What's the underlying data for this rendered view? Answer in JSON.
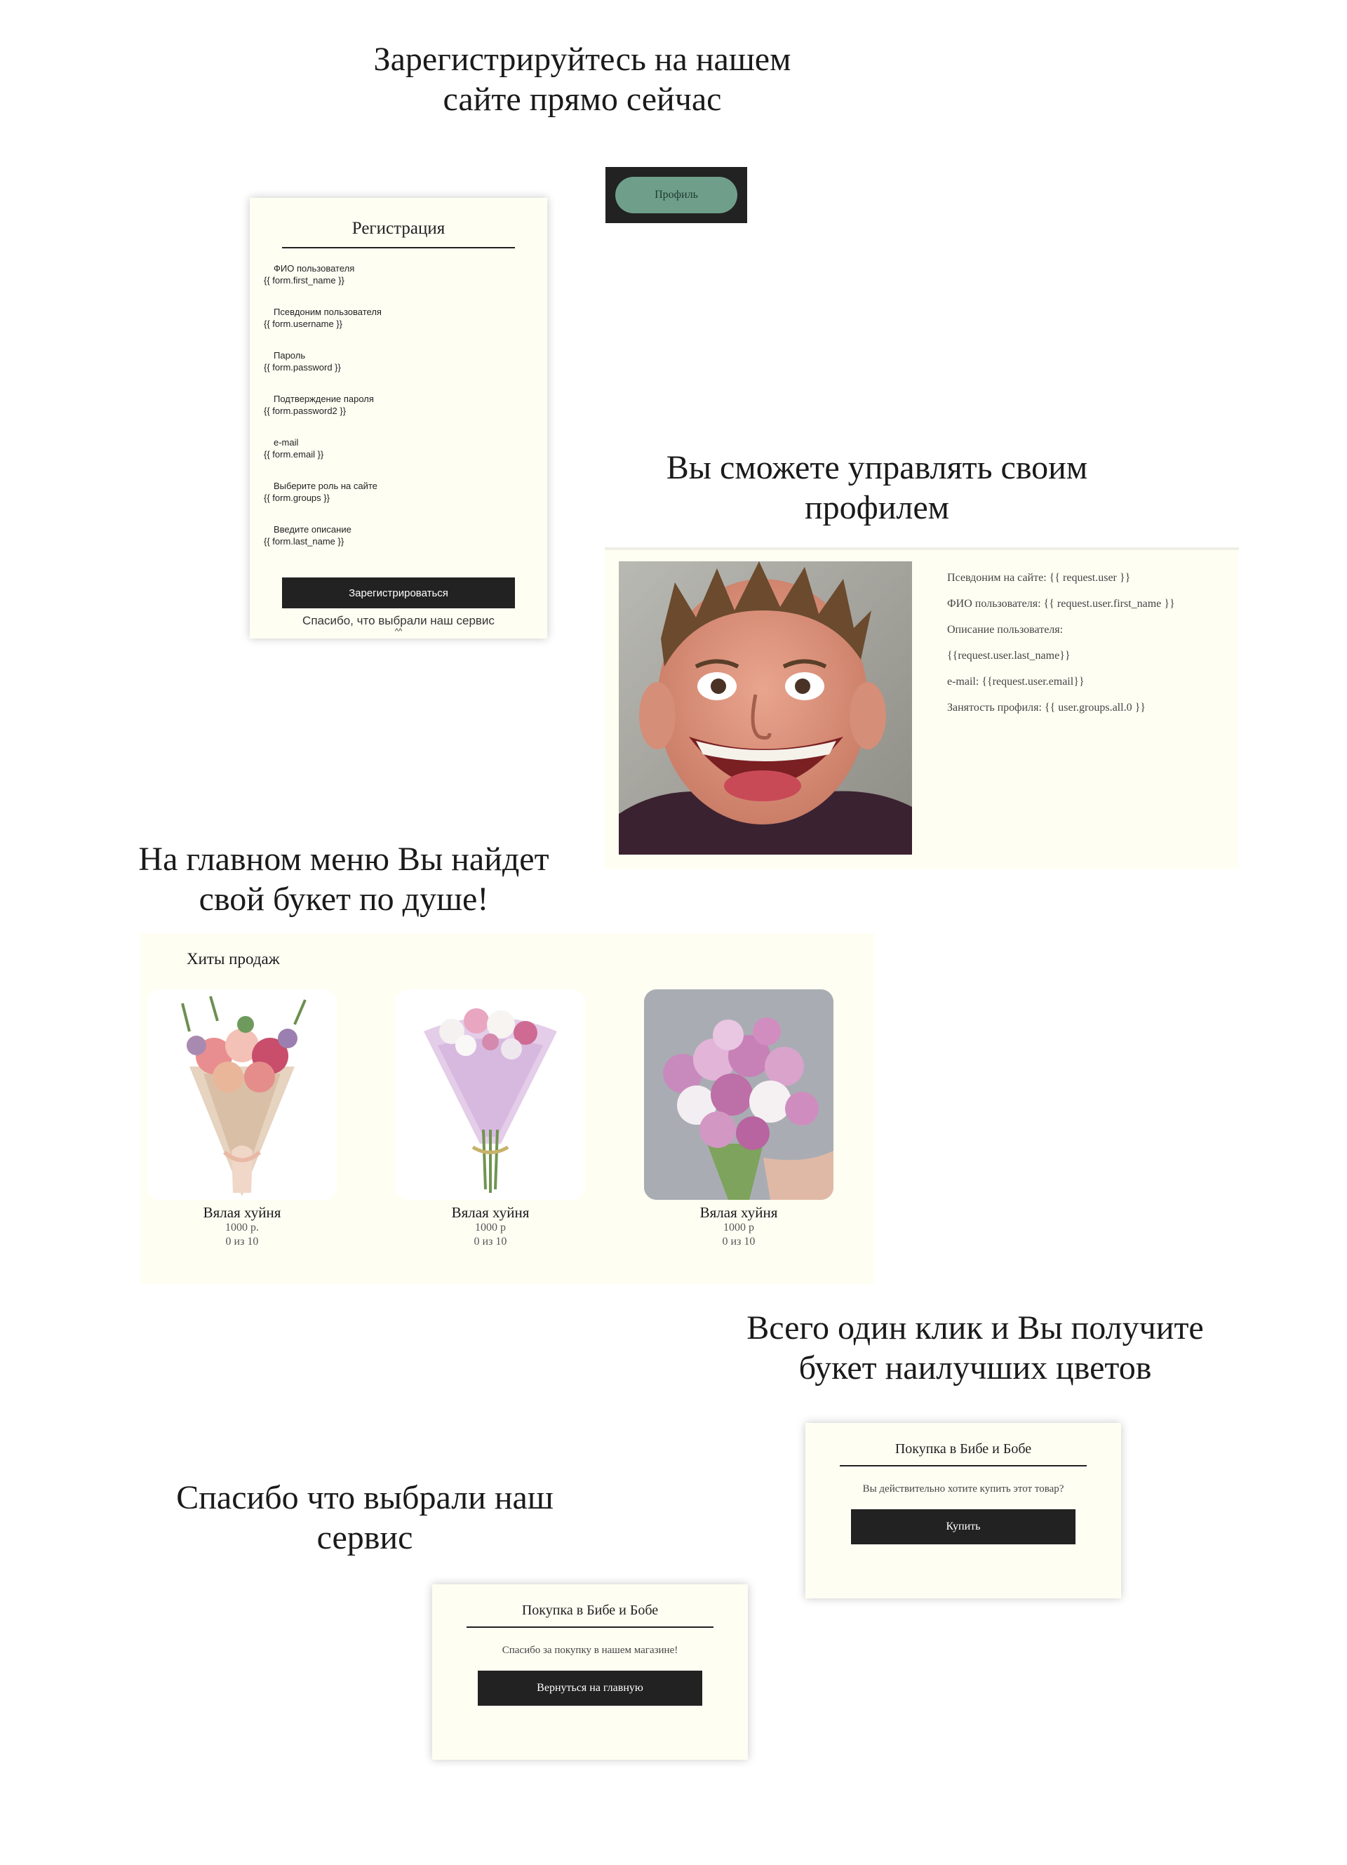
{
  "headings": {
    "register": [
      "Зарегистрируйтесь на нашем",
      "сайте прямо сейчас"
    ],
    "profile": [
      "Вы сможете управлять своим",
      "профилем"
    ],
    "menu": [
      "На главном меню Вы найдет",
      "свой букет по душе!"
    ],
    "click": [
      "Всего один клик и Вы получите",
      "букет наилучших цветов"
    ],
    "thanks": [
      "Спасибо что выбрали наш",
      "сервис"
    ]
  },
  "registration": {
    "title": "Регистрация",
    "fields": [
      {
        "label": "ФИО пользователя",
        "value": "{{ form.first_name }}"
      },
      {
        "label": "Псевдоним пользователя",
        "value": "{{ form.username }}"
      },
      {
        "label": "Пароль",
        "value": "{{ form.password }}"
      },
      {
        "label": "Подтверждение пароля",
        "value": "{{ form.password2 }}"
      },
      {
        "label": "e-mail",
        "value": "{{ form.email }}"
      },
      {
        "label": "Выберите роль на сайте",
        "value": "{{ form.groups }}"
      },
      {
        "label": "Введите описание",
        "value": "{{ form.last_name }}"
      }
    ],
    "submit_label": "Зарегистрироваться",
    "thanks": "Спасибо, что выбрали наш сервис",
    "caret": "^^"
  },
  "profile_button": {
    "label": "Профиль"
  },
  "profile": {
    "lines": [
      "Псевдоним на сайте: {{ request.user }}",
      "ФИО пользователя: {{ request.user.first_name }}",
      "Описание пользователя:",
      "{{request.user.last_name}}",
      "e-mail: {{request.user.email}}",
      "Занятость профиля: {{ user.groups.all.0 }}"
    ]
  },
  "catalog": {
    "section_title": "Хиты продаж",
    "products": [
      {
        "name": "Вялая хуйня",
        "price": "1000 р.",
        "stock": "0 из 10"
      },
      {
        "name": "Вялая хуйня",
        "price": "1000 р",
        "stock": "0 из 10"
      },
      {
        "name": "Вялая хуйня",
        "price": "1000 р",
        "stock": "0 из 10"
      }
    ]
  },
  "purchase": {
    "title": "Покупка в Бибе и Бобе",
    "message": "Вы действительно хотите купить этот товар?",
    "button_label": "Купить"
  },
  "purchase_done": {
    "title": "Покупка в Бибе и Бобе",
    "message": "Спасибо за покупку в нашем магазине!",
    "button_label": "Вернуться на главную"
  },
  "colors": {
    "card_bg": "#fffef3",
    "dark": "#222222",
    "profile_button": "#6f9f8a"
  }
}
